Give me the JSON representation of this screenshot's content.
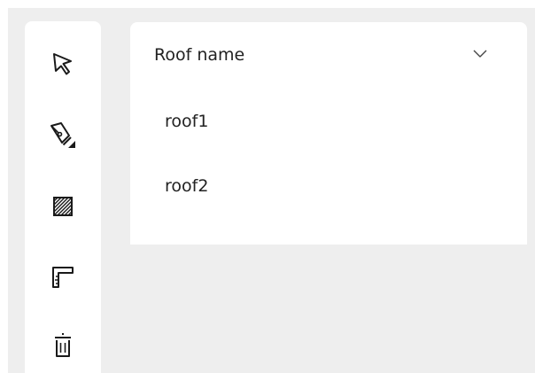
{
  "toolbar": {
    "tools": [
      {
        "icon": "cursor-arrow-icon"
      },
      {
        "icon": "pen-tool-icon"
      },
      {
        "icon": "hatched-area-icon"
      },
      {
        "icon": "corner-ruler-icon"
      },
      {
        "icon": "trash-icon"
      }
    ]
  },
  "dropdown": {
    "title": "Roof name",
    "expanded": true,
    "options": [
      {
        "label": "roof1"
      },
      {
        "label": "roof2"
      }
    ]
  }
}
